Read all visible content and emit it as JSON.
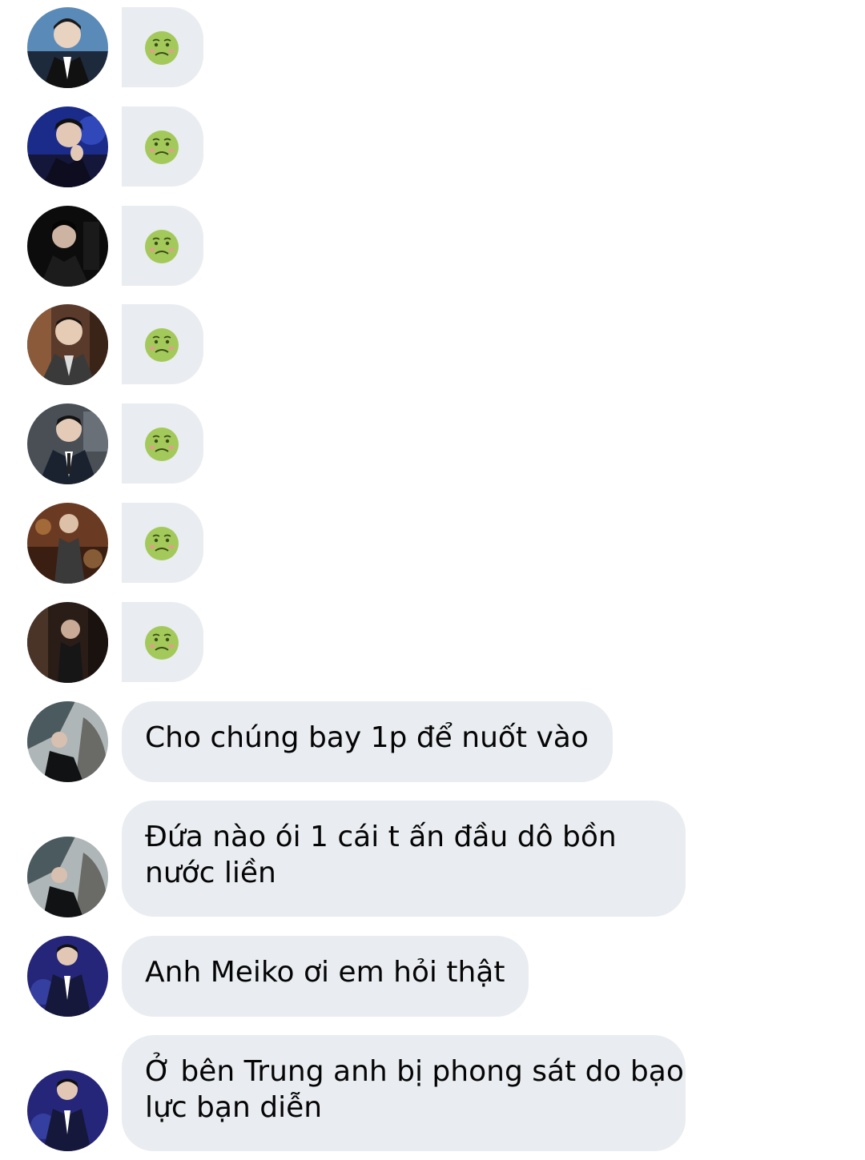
{
  "conversation": {
    "messages": [
      {
        "type": "emoji",
        "emoji": "nauseated-face"
      },
      {
        "type": "emoji",
        "emoji": "nauseated-face"
      },
      {
        "type": "emoji",
        "emoji": "nauseated-face"
      },
      {
        "type": "emoji",
        "emoji": "nauseated-face"
      },
      {
        "type": "emoji",
        "emoji": "nauseated-face"
      },
      {
        "type": "emoji",
        "emoji": "nauseated-face"
      },
      {
        "type": "emoji",
        "emoji": "nauseated-face"
      },
      {
        "type": "text",
        "lines": [
          "Cho chúng bay 1p để nuốt vào"
        ]
      },
      {
        "type": "text",
        "lines": [
          "Đứa nào ói 1 cái t ấn đầu dô bồn",
          "nước liền"
        ]
      },
      {
        "type": "text",
        "lines": [
          "Anh Meiko ơi em hỏi thật"
        ]
      },
      {
        "type": "text",
        "lines": [
          "Ở bên Trung anh bị phong sát do bạo",
          "lực bạn diễn"
        ]
      }
    ]
  },
  "colors": {
    "bubble": "#e9ecf0",
    "text": "#050505",
    "emoji_face": "#a3c95a"
  }
}
